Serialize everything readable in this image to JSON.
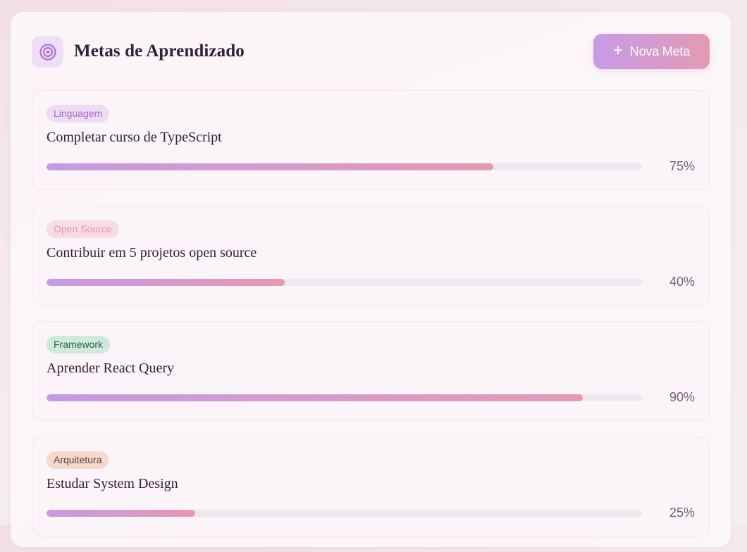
{
  "header": {
    "title": "Metas de Aprendizado",
    "icon": "target-icon",
    "new_button_label": "Nova Meta",
    "new_button_icon": "plus-icon"
  },
  "colors": {
    "accent_start": "#c69be6",
    "accent_end": "#e49ab4"
  },
  "goals": [
    {
      "tag": "Linguagem",
      "tag_bg": "#ecdcf4",
      "tag_color": "#a86bc7",
      "title": "Completar curso de TypeScript",
      "progress": 75,
      "progress_label": "75%"
    },
    {
      "tag": "Open Source",
      "tag_bg": "#f8dce5",
      "tag_color": "#e494ae",
      "title": "Contribuir em 5 projetos open source",
      "progress": 40,
      "progress_label": "40%"
    },
    {
      "tag": "Framework",
      "tag_bg": "#cdeadd",
      "tag_color": "#2f5a4c",
      "title": "Aprender React Query",
      "progress": 90,
      "progress_label": "90%"
    },
    {
      "tag": "Arquitetura",
      "tag_bg": "#f4d9cc",
      "tag_color": "#5b3a36",
      "title": "Estudar System Design",
      "progress": 25,
      "progress_label": "25%"
    }
  ]
}
